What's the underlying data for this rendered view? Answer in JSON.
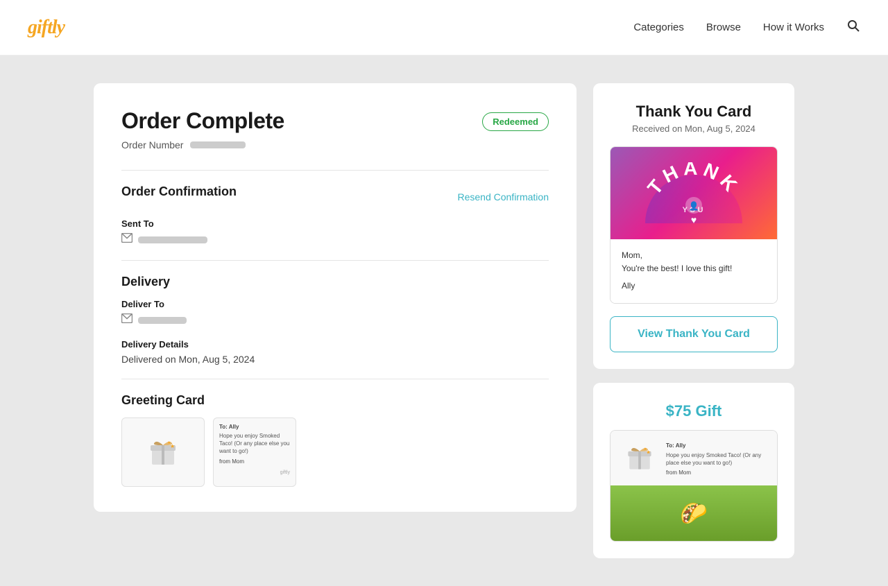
{
  "header": {
    "logo": "giftly",
    "nav": {
      "categories": "Categories",
      "browse": "Browse",
      "how_it_works": "How it Works"
    }
  },
  "left": {
    "order_title": "Order Complete",
    "redeemed_badge": "Redeemed",
    "order_number_label": "Order Number",
    "sections": {
      "order_confirmation": {
        "title": "Order Confirmation",
        "resend_link": "Resend Confirmation",
        "sent_to_label": "Sent To"
      },
      "delivery": {
        "title": "Delivery",
        "deliver_to_label": "Deliver To",
        "delivery_details_label": "Delivery Details",
        "delivery_date": "Delivered on Mon, Aug 5, 2024"
      },
      "greeting_card": {
        "title": "Greeting Card"
      }
    }
  },
  "right": {
    "thank_you_card": {
      "title": "Thank You Card",
      "subtitle": "Received on Mon, Aug 5, 2024",
      "card_top_thank": "THANK",
      "card_top_you": "YOU",
      "card_message_line1": "Mom,",
      "card_message_line2": "You're the best! I love this gift!",
      "card_message_line3": "Ally",
      "view_button": "View Thank You Card"
    },
    "gift": {
      "amount": "$75 Gift",
      "message_line1": "To: Ally",
      "message_line2": "Hope you enjoy Smoked Taco! (Or any place else you want to go!)",
      "message_line3": "from Mom"
    }
  }
}
